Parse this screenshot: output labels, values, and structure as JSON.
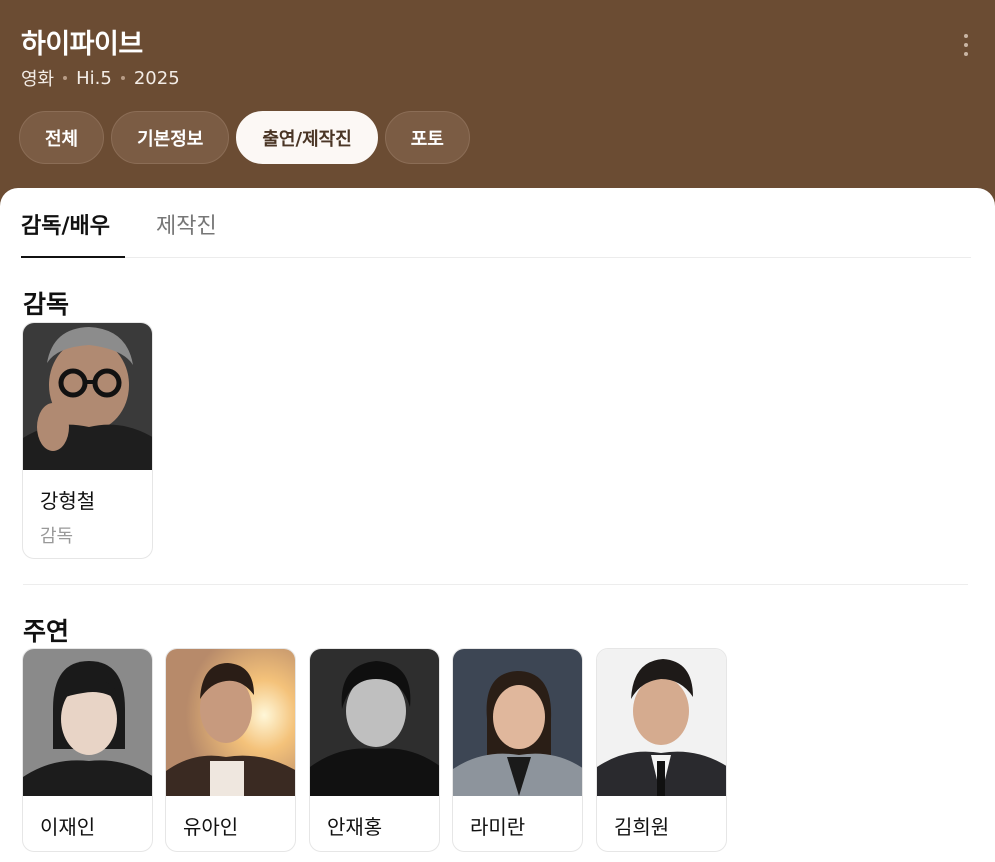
{
  "header": {
    "title": "하이파이브",
    "meta": [
      "영화",
      "Hi.5",
      "2025"
    ],
    "more_icon": "vertical-ellipsis-icon"
  },
  "tabs": [
    {
      "label": "전체",
      "active": false
    },
    {
      "label": "기본정보",
      "active": false
    },
    {
      "label": "출연/제작진",
      "active": true
    },
    {
      "label": "포토",
      "active": false
    }
  ],
  "subtabs": [
    {
      "label": "감독/배우",
      "active": true
    },
    {
      "label": "제작진",
      "active": false
    }
  ],
  "sections": {
    "director": {
      "title": "감독",
      "people": [
        {
          "name": "강형철",
          "role": "감독"
        }
      ]
    },
    "lead": {
      "title": "주연",
      "people": [
        {
          "name": "이재인"
        },
        {
          "name": "유아인"
        },
        {
          "name": "안재홍"
        },
        {
          "name": "라미란"
        },
        {
          "name": "김희원"
        }
      ]
    }
  },
  "colors": {
    "header_bg": "#6b4c33",
    "active_pill_bg": "#fcf8f5",
    "active_pill_text": "#4a3525"
  }
}
